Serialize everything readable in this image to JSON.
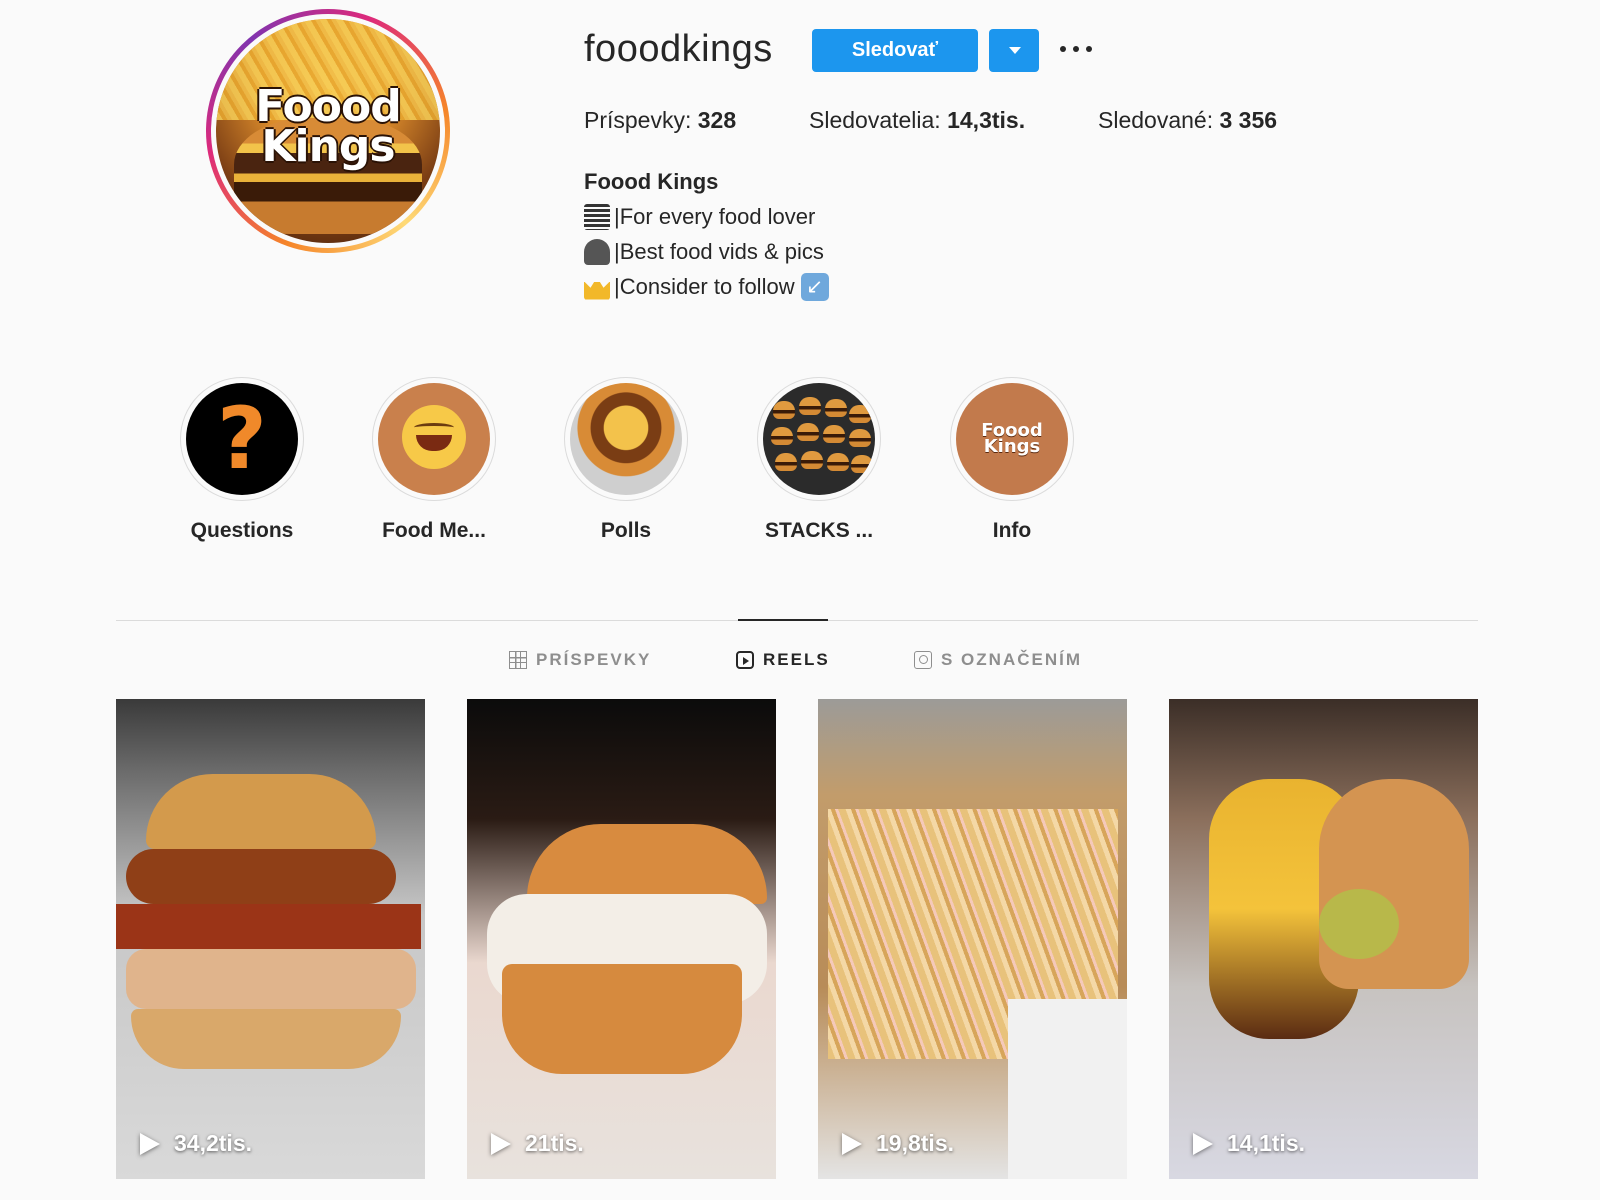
{
  "profile": {
    "username": "fooodkings",
    "follow_label": "Sledovať",
    "avatar_text_line1": "Foood",
    "avatar_text_line2": "Kings"
  },
  "stats": {
    "posts_label": "Príspevky:",
    "posts_value": "328",
    "followers_label": "Sledovatelia:",
    "followers_value": "14,3tis.",
    "following_label": "Sledované:",
    "following_value": "3 356"
  },
  "bio": {
    "name": "Foood Kings",
    "line1": "|For every food lover",
    "line2": "|Best food vids & pics",
    "line3": "|Consider to follow"
  },
  "highlights": [
    {
      "label": "Questions"
    },
    {
      "label": "Food Me..."
    },
    {
      "label": "Polls"
    },
    {
      "label": "STACKS ..."
    },
    {
      "label": "Info",
      "image_text_line1": "Foood",
      "image_text_line2": "Kings"
    }
  ],
  "tabs": {
    "posts": "PRÍSPEVKY",
    "reels": "REELS",
    "tagged": "S OZNAČENÍM"
  },
  "reels": [
    {
      "views": "34,2tis."
    },
    {
      "views": "21tis."
    },
    {
      "views": "19,8tis."
    },
    {
      "views": "14,1tis."
    }
  ],
  "colors": {
    "accent": "#1c96ee",
    "background": "#fafafa",
    "text": "#262626",
    "muted": "#8e8e8e"
  }
}
